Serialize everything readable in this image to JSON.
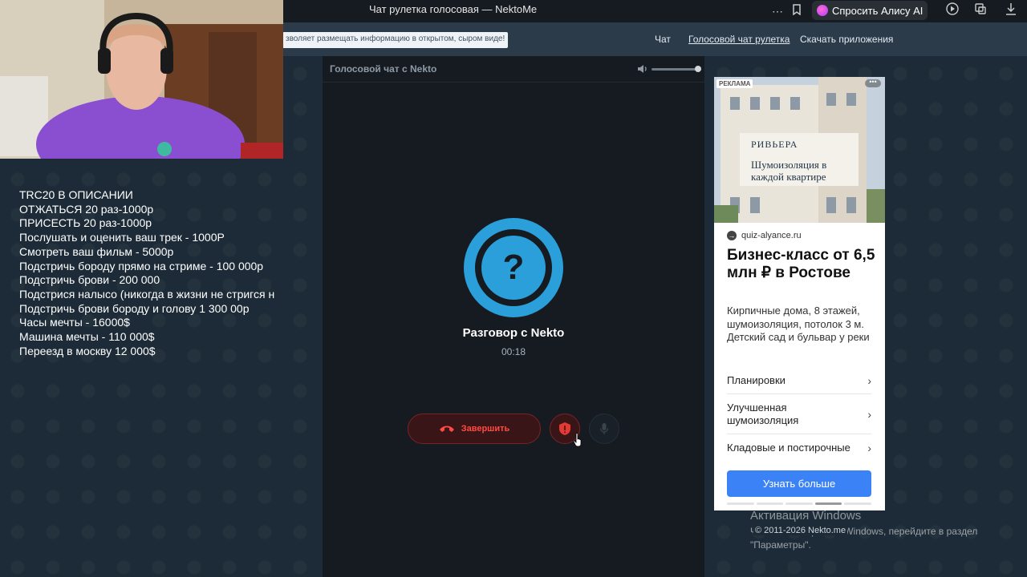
{
  "browser": {
    "tab_title": "Чат рулетка голосовая — NektoMe",
    "alice_label": "Спросить Алису AI"
  },
  "nav": {
    "notice": "зволяет размещать информацию в открытом, сыром виде!",
    "links": [
      "Чат",
      "Голосовой чат рулетка",
      "Скачать приложения"
    ]
  },
  "chat": {
    "header_title": "Голосовой чат с Nekto",
    "avatar_symbol": "?",
    "conversation_title": "Разговор с Nekto",
    "timer": "00:18",
    "end_label": "Завершить",
    "volume_level": 1.0
  },
  "overlay": {
    "lines": [
      "TRC20 В ОПИСАНИИ",
      "ОТЖАТЬСЯ 20 раз-1000р",
      "ПРИСЕСТЬ 20 раз-1000р",
      "Послушать и оценить ваш трек - 1000Р",
      "Смотреть ваш фильм - 5000р",
      "Подстричь бороду прямо на стриме - 100 000р",
      "Подстричь брови - 200 000",
      "Подстрися налысо (никогда в жизни не стригся н",
      "Подстричь брови бороду и голову 1 300 00р",
      "Часы мечты - 16000$",
      "Машина мечты - 110 000$",
      "Переезд в москву 12 000$"
    ]
  },
  "ad": {
    "label": "РЕКЛАМА",
    "more": "•••",
    "brand": "РИВЬЕРА",
    "banner_text": "Шумоизоляция в каждой квартире",
    "domain": "quiz-alyance.ru",
    "headline": "Бизнес-класс от 6,5 млн ₽ в Ростове",
    "description": "Кирпичные дома, 8 этажей, шумоизоляция, потолок 3 м. Детский сад и бульвар у реки",
    "items": [
      "Планировки",
      "Улучшенная шумоизоляция",
      "Кладовые и постирочные"
    ],
    "cta": "Узнать больше"
  },
  "footer": {
    "copyright": "© 2011-2026 Nekto.me",
    "win_title": "Активация Windows",
    "win_sub": "Чтобы активировать Windows, перейдите в раздел \"Параметры\"."
  },
  "colors": {
    "accent": "#2a9fd9",
    "danger": "#ff4b42",
    "cta": "#3b82f6"
  }
}
